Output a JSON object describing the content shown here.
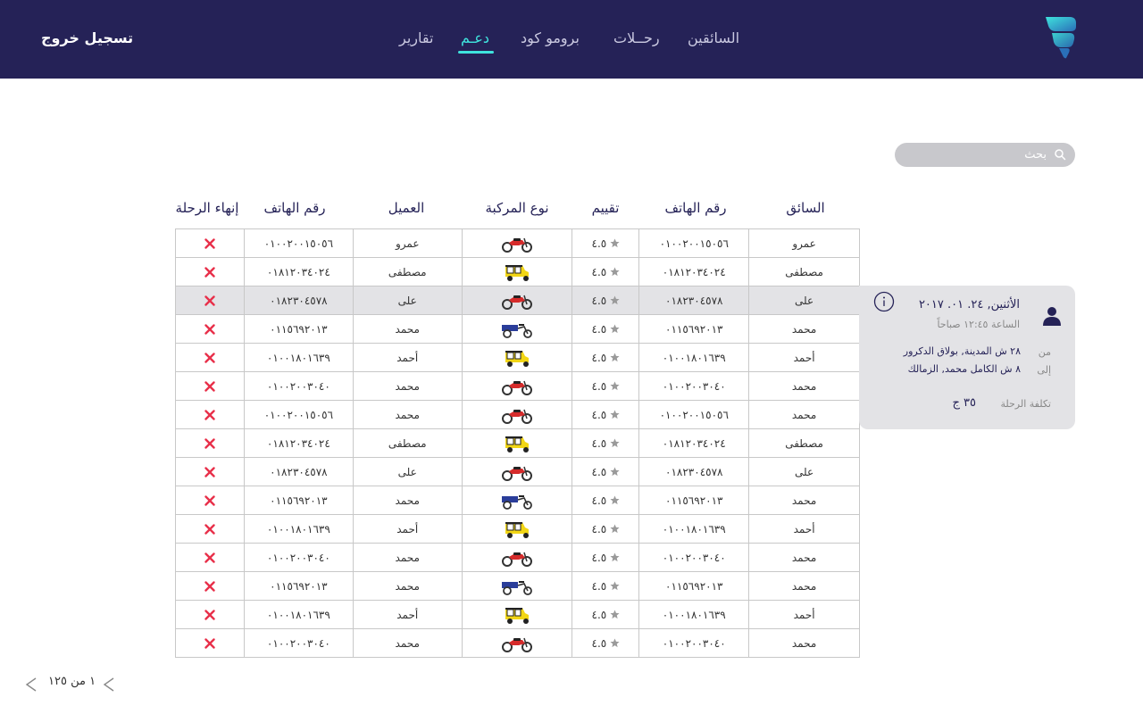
{
  "header": {
    "nav": [
      {
        "label": "السائقين",
        "active": false
      },
      {
        "label": "رحــلات",
        "active": false
      },
      {
        "label": "برومو كود",
        "active": false
      },
      {
        "label": "دعـم",
        "active": true
      },
      {
        "label": "تقارير",
        "active": false
      }
    ],
    "logout_label": "تسجيل خروج",
    "colors": {
      "bar": "#252257",
      "accent": "#3fe3dd"
    }
  },
  "search": {
    "placeholder": "بحث",
    "icon": "search-icon"
  },
  "table": {
    "headers": {
      "driver": "السائق",
      "phone": "رقم الهاتف",
      "rating": "تقييم",
      "vehicle": "نوع المركبة",
      "client": "العميل",
      "client_phone": "رقم الهاتف",
      "end_trip": "إنهاء الرحلة"
    },
    "rows": [
      {
        "driver": "عمرو",
        "phone": "٠١٠٠٢٠٠١٥٠٥٦",
        "rating": "٤.٥",
        "vehicle": "motorcycle",
        "client": "عمرو",
        "client_phone": "٠١٠٠٢٠٠١٥٠٥٦",
        "selected": false
      },
      {
        "driver": "مصطفى",
        "phone": "٠١٨١٢٠٣٤٠٢٤",
        "rating": "٤.٥",
        "vehicle": "tuktuk",
        "client": "مصطفى",
        "client_phone": "٠١٨١٢٠٣٤٠٢٤",
        "selected": false
      },
      {
        "driver": "على",
        "phone": "٠١٨٢٣٠٤٥٧٨",
        "rating": "٤.٥",
        "vehicle": "motorcycle",
        "client": "على",
        "client_phone": "٠١٨٢٣٠٤٥٧٨",
        "selected": true
      },
      {
        "driver": "محمد",
        "phone": "٠١١٥٦٩٢٠١٣",
        "rating": "٤.٥",
        "vehicle": "tricycle",
        "client": "محمد",
        "client_phone": "٠١١٥٦٩٢٠١٣",
        "selected": false
      },
      {
        "driver": "أحمد",
        "phone": "٠١٠٠١٨٠١٦٣٩",
        "rating": "٤.٥",
        "vehicle": "tuktuk",
        "client": "أحمد",
        "client_phone": "٠١٠٠١٨٠١٦٣٩",
        "selected": false
      },
      {
        "driver": "محمد",
        "phone": "٠١٠٠٢٠٠٣٠٤٠",
        "rating": "٤.٥",
        "vehicle": "motorcycle",
        "client": "محمد",
        "client_phone": "٠١٠٠٢٠٠٣٠٤٠",
        "selected": false
      },
      {
        "driver": "محمد",
        "phone": "٠١٠٠٢٠٠١٥٠٥٦",
        "rating": "٤.٥",
        "vehicle": "motorcycle",
        "client": "محمد",
        "client_phone": "٠١٠٠٢٠٠١٥٠٥٦",
        "selected": false
      },
      {
        "driver": "مصطفى",
        "phone": "٠١٨١٢٠٣٤٠٢٤",
        "rating": "٤.٥",
        "vehicle": "tuktuk",
        "client": "مصطفى",
        "client_phone": "٠١٨١٢٠٣٤٠٢٤",
        "selected": false
      },
      {
        "driver": "على",
        "phone": "٠١٨٢٣٠٤٥٧٨",
        "rating": "٤.٥",
        "vehicle": "motorcycle",
        "client": "على",
        "client_phone": "٠١٨٢٣٠٤٥٧٨",
        "selected": false
      },
      {
        "driver": "محمد",
        "phone": "٠١١٥٦٩٢٠١٣",
        "rating": "٤.٥",
        "vehicle": "tricycle",
        "client": "محمد",
        "client_phone": "٠١١٥٦٩٢٠١٣",
        "selected": false
      },
      {
        "driver": "أحمد",
        "phone": "٠١٠٠١٨٠١٦٣٩",
        "rating": "٤.٥",
        "vehicle": "tuktuk",
        "client": "أحمد",
        "client_phone": "٠١٠٠١٨٠١٦٣٩",
        "selected": false
      },
      {
        "driver": "محمد",
        "phone": "٠١٠٠٢٠٠٣٠٤٠",
        "rating": "٤.٥",
        "vehicle": "motorcycle",
        "client": "محمد",
        "client_phone": "٠١٠٠٢٠٠٣٠٤٠",
        "selected": false
      },
      {
        "driver": "محمد",
        "phone": "٠١١٥٦٩٢٠١٣",
        "rating": "٤.٥",
        "vehicle": "tricycle",
        "client": "محمد",
        "client_phone": "٠١١٥٦٩٢٠١٣",
        "selected": false
      },
      {
        "driver": "أحمد",
        "phone": "٠١٠٠١٨٠١٦٣٩",
        "rating": "٤.٥",
        "vehicle": "tuktuk",
        "client": "أحمد",
        "client_phone": "٠١٠٠١٨٠١٦٣٩",
        "selected": false
      },
      {
        "driver": "محمد",
        "phone": "٠١٠٠٢٠٠٣٠٤٠",
        "rating": "٤.٥",
        "vehicle": "motorcycle",
        "client": "محمد",
        "client_phone": "٠١٠٠٢٠٠٣٠٤٠",
        "selected": false
      }
    ]
  },
  "trip_card": {
    "date": "الأثنين, ٢٤. ٠١. ٢٠١٧",
    "time": "الساعة ١٢:٤٥ صباحاً",
    "from_label": "من",
    "from_address": "٢٨ ش المدينة, بولاق الدكرور",
    "to_label": "إلى",
    "to_address": "٨ ش الكامل محمد, الزمالك",
    "cost_label": "تكلفة الرحلة",
    "cost_value": "٣٥ ج"
  },
  "pagination": {
    "text": "١ من ١٢٥"
  }
}
